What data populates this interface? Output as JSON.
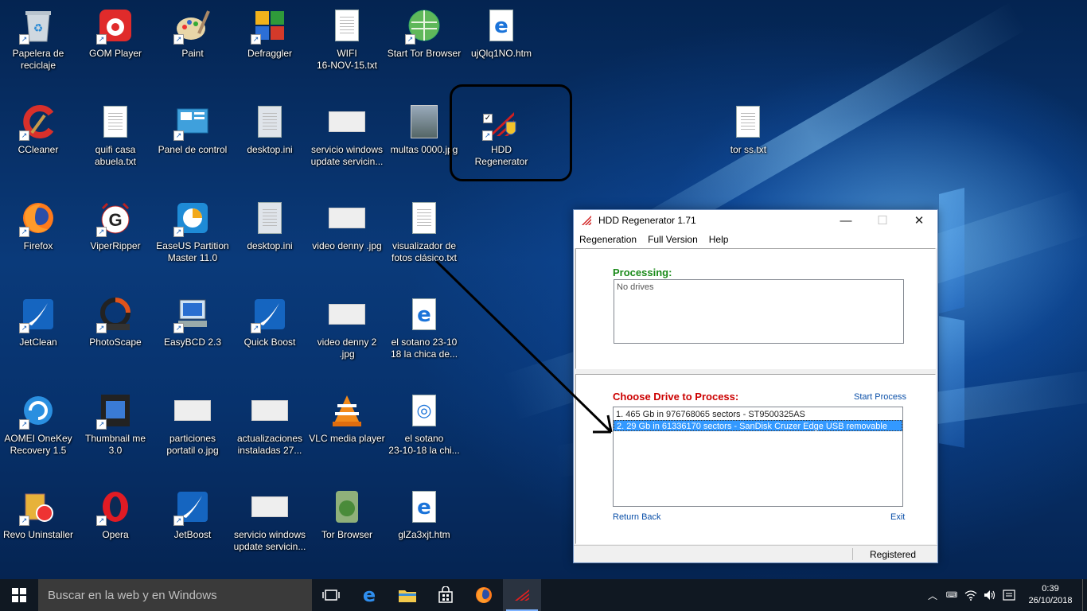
{
  "desktop": {
    "icons": [
      {
        "label": "Papelera de\nreciclaje",
        "icon": "recycle-bin-icon"
      },
      {
        "label": "GOM Player",
        "icon": "gom-player-icon"
      },
      {
        "label": "Paint",
        "icon": "paint-icon"
      },
      {
        "label": "Defraggler",
        "icon": "defraggler-icon"
      },
      {
        "label": "WIFI\n16-NOV-15.txt",
        "icon": "text-file-icon"
      },
      {
        "label": "Start Tor Browser",
        "icon": "tor-globe-icon"
      },
      {
        "label": "ujQlq1NO.htm",
        "icon": "ie-html-icon"
      },
      {
        "label": "CCleaner",
        "icon": "ccleaner-icon"
      },
      {
        "label": "quifi casa\nabuela.txt",
        "icon": "text-file-icon"
      },
      {
        "label": "Panel de control",
        "icon": "control-panel-icon"
      },
      {
        "label": "desktop.ini",
        "icon": "settings-file-icon"
      },
      {
        "label": "servicio windows\nupdate servicin...",
        "icon": "image-thumb-icon"
      },
      {
        "label": "multas 0000.jpg",
        "icon": "photo-thumb-icon"
      },
      {
        "label": "HDD Regenerator",
        "icon": "hdd-regenerator-icon"
      },
      {
        "label": "tor ss.txt",
        "icon": "text-file-icon"
      },
      {
        "label": "Firefox",
        "icon": "firefox-icon"
      },
      {
        "label": "ViperRipper",
        "icon": "viperripper-icon"
      },
      {
        "label": "EaseUS Partition\nMaster 11.0",
        "icon": "easeus-icon"
      },
      {
        "label": "desktop.ini",
        "icon": "settings-file-icon"
      },
      {
        "label": "video denny .jpg",
        "icon": "image-thumb-icon"
      },
      {
        "label": "visualizador de\nfotos clásico.txt",
        "icon": "text-file-icon"
      },
      {
        "label": "JetClean",
        "icon": "jetclean-icon"
      },
      {
        "label": "PhotoScape",
        "icon": "photoscape-icon"
      },
      {
        "label": "EasyBCD 2.3",
        "icon": "easybcd-icon"
      },
      {
        "label": "Quick Boost",
        "icon": "quick-boost-icon"
      },
      {
        "label": "video denny 2\n.jpg",
        "icon": "image-thumb-icon"
      },
      {
        "label": "el sotano 23-10\n18 la chica de...",
        "icon": "ie-html-icon"
      },
      {
        "label": "AOMEI OneKey\nRecovery 1.5",
        "icon": "aomei-icon"
      },
      {
        "label": "Thumbnail me\n3.0",
        "icon": "thumbnail-me-icon"
      },
      {
        "label": "particiones\nportatil o.jpg",
        "icon": "image-thumb-icon"
      },
      {
        "label": "actualizaciones\ninstaladas 27...",
        "icon": "image-thumb-icon"
      },
      {
        "label": "VLC media player",
        "icon": "vlc-icon"
      },
      {
        "label": "el sotano\n23-10-18 la chi...",
        "icon": "media-file-icon"
      },
      {
        "label": "Revo Uninstaller",
        "icon": "revo-uninstaller-icon"
      },
      {
        "label": "Opera",
        "icon": "opera-icon"
      },
      {
        "label": "JetBoost",
        "icon": "jetboost-icon"
      },
      {
        "label": "servicio windows\nupdate servicin...",
        "icon": "image-thumb-icon"
      },
      {
        "label": "Tor Browser",
        "icon": "tor-browser-icon"
      },
      {
        "label": "glZa3xjt.htm",
        "icon": "ie-html-icon"
      }
    ]
  },
  "window": {
    "title": "HDD Regenerator 1.71",
    "menu": [
      "Regeneration",
      "Full Version",
      "Help"
    ],
    "processing_title": "Processing:",
    "processing_list": [
      "No drives"
    ],
    "choose_title": "Choose Drive to Process:",
    "start_process": "Start Process",
    "drives": [
      "1. 465 Gb in 976768065 sectors  -  ST9500325AS",
      "2. 29 Gb in 61336170 sectors  -  SanDisk Cruzer Edge  USB removable"
    ],
    "selected_drive_index": 1,
    "return_back": "Return Back",
    "exit": "Exit",
    "status": "Registered",
    "colors": {
      "processing_title": "#1a8a1a",
      "choose_title": "#cc0000",
      "selection": "#3399ff"
    }
  },
  "taskbar": {
    "search_placeholder": "Buscar en la web y en Windows",
    "pinned": [
      "task-view-icon",
      "edge-icon",
      "file-explorer-icon",
      "store-icon",
      "firefox-icon",
      "hdd-regenerator-icon"
    ],
    "active_app": "hdd-regenerator-icon",
    "time": "0:39",
    "date": "26/10/2018"
  }
}
